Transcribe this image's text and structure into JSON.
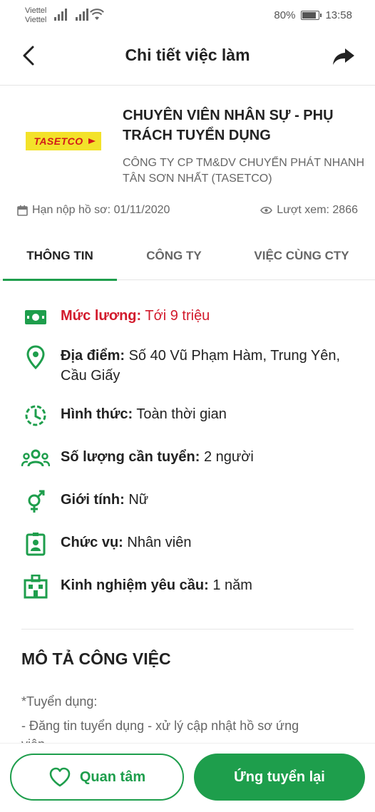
{
  "status": {
    "carrier1": "Viettel",
    "carrier2": "Viettel",
    "battery": "80%",
    "time": "13:58"
  },
  "header": {
    "title": "Chi tiết việc làm"
  },
  "job": {
    "logo_text": "TASETCO",
    "title": "CHUYÊN VIÊN NHÂN SỰ - PHỤ TRÁCH TUYỂN DỤNG",
    "company": "CÔNG TY CP TM&DV CHUYỂN PHÁT NHANH TÂN SƠN NHẤT (TASETCO)",
    "deadline": "Hạn nộp hồ sơ: 01/11/2020",
    "views": "Lượt xem: 2866"
  },
  "tabs": [
    "THÔNG TIN",
    "CÔNG TY",
    "VIỆC CÙNG CTY"
  ],
  "details": {
    "salary": {
      "label": "Mức lương:",
      "value": "Tới 9 triệu"
    },
    "location": {
      "label": "Địa điểm:",
      "value": "Số 40 Vũ Phạm Hàm, Trung Yên, Cầu Giấy"
    },
    "type": {
      "label": "Hình thức:",
      "value": "Toàn thời gian"
    },
    "quantity": {
      "label": "Số lượng cần tuyển:",
      "value": "2 người"
    },
    "gender": {
      "label": "Giới tính:",
      "value": "Nữ"
    },
    "position": {
      "label": "Chức vụ:",
      "value": "Nhân viên"
    },
    "experience": {
      "label": "Kinh nghiệm yêu cầu:",
      "value": "1 năm"
    }
  },
  "description": {
    "title": "MÔ TẢ CÔNG VIỆC",
    "lines": [
      "*Tuyển dụng:",
      "- Đăng tin tuyển dụng - xử lý cập nhật hồ sơ ứng",
      "viên"
    ]
  },
  "actions": {
    "follow": "Quan tâm",
    "apply": "Ứng tuyển lại"
  },
  "colors": {
    "accent": "#1e9e4c",
    "salary": "#d21a2c"
  }
}
